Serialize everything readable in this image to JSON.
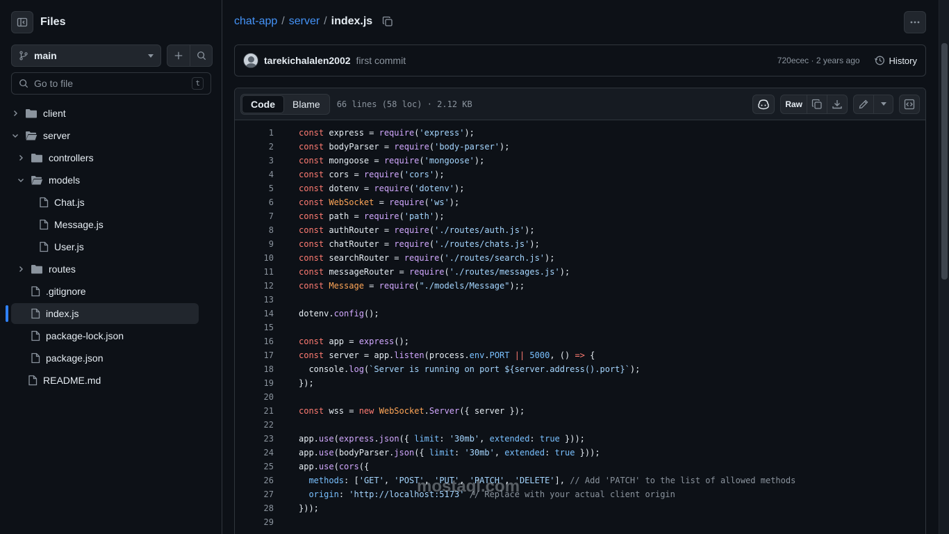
{
  "sidebar": {
    "title": "Files",
    "branch": "main",
    "goto_placeholder": "Go to file",
    "goto_shortcut": "t",
    "tree": [
      {
        "label": "client",
        "type": "folder",
        "expanded": false,
        "depth": 0
      },
      {
        "label": "server",
        "type": "folder",
        "expanded": true,
        "depth": 0
      },
      {
        "label": "controllers",
        "type": "folder",
        "expanded": false,
        "depth": 1
      },
      {
        "label": "models",
        "type": "folder",
        "expanded": true,
        "depth": 1
      },
      {
        "label": "Chat.js",
        "type": "file",
        "depth": 2
      },
      {
        "label": "Message.js",
        "type": "file",
        "depth": 2
      },
      {
        "label": "User.js",
        "type": "file",
        "depth": 2
      },
      {
        "label": "routes",
        "type": "folder",
        "expanded": false,
        "depth": 1
      },
      {
        "label": ".gitignore",
        "type": "file",
        "depth": 1
      },
      {
        "label": "index.js",
        "type": "file",
        "depth": 1,
        "active": true
      },
      {
        "label": "package-lock.json",
        "type": "file",
        "depth": 1
      },
      {
        "label": "package.json",
        "type": "file",
        "depth": 1
      },
      {
        "label": "README.md",
        "type": "file",
        "depth": 0
      }
    ]
  },
  "breadcrumb": {
    "repo": "chat-app",
    "folder": "server",
    "file": "index.js",
    "sep": "/"
  },
  "commit": {
    "author": "tarekichalalen2002",
    "message": "first commit",
    "meta": "720ecec · 2 years ago",
    "history_label": "History"
  },
  "file_header": {
    "tab_code": "Code",
    "tab_blame": "Blame",
    "info": "66 lines (58 loc) · 2.12 KB",
    "raw_label": "Raw"
  },
  "code_lines": [
    "const express = require('express');",
    "const bodyParser = require('body-parser');",
    "const mongoose = require('mongoose');",
    "const cors = require('cors');",
    "const dotenv = require('dotenv');",
    "const WebSocket = require('ws');",
    "const path = require('path');",
    "const authRouter = require('./routes/auth.js');",
    "const chatRouter = require('./routes/chats.js');",
    "const searchRouter = require('./routes/search.js');",
    "const messageRouter = require('./routes/messages.js');",
    "const Message = require(\"./models/Message\");;",
    "",
    "dotenv.config();",
    "",
    "const app = express();",
    "const server = app.listen(process.env.PORT || 5000, () => {",
    "  console.log(`Server is running on port ${server.address().port}`);",
    "});",
    "",
    "const wss = new WebSocket.Server({ server });",
    "",
    "app.use(express.json({ limit: '30mb', extended: true }));",
    "app.use(bodyParser.json({ limit: '30mb', extended: true }));",
    "app.use(cors({",
    "  methods: ['GET', 'POST', 'PUT', 'PATCH', 'DELETE'], // Add 'PATCH' to the list of allowed methods",
    "  origin: 'http://localhost:5173' // Replace with your actual client origin",
    "}));",
    ""
  ],
  "watermark": "mostaql.com",
  "colors": {
    "background": "#0d1117",
    "link": "#4493f8",
    "keyword": "#ff7b72",
    "function": "#d2a8ff",
    "string": "#a5d6ff",
    "active_indicator": "#2f81f7"
  }
}
